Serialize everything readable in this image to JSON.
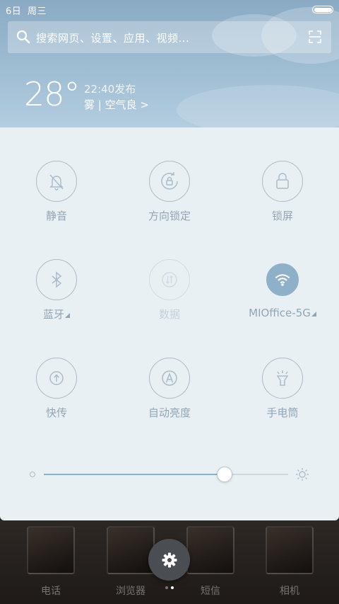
{
  "status_bar": {
    "date": "6日",
    "weekday": "周三"
  },
  "search": {
    "placeholder": "搜索网页、设置、应用、视频..."
  },
  "weather": {
    "temperature": "28°",
    "publish_time": "22:40发布",
    "condition": "雾 | 空气良 >"
  },
  "quick_settings": {
    "tiles": [
      {
        "label": "静音",
        "icon": "bell-off-icon",
        "state": "off"
      },
      {
        "label": "方向锁定",
        "icon": "rotation-lock-icon",
        "state": "off"
      },
      {
        "label": "锁屏",
        "icon": "lock-icon",
        "state": "off"
      },
      {
        "label": "蓝牙",
        "icon": "bluetooth-icon",
        "state": "off",
        "expandable": true
      },
      {
        "label": "数据",
        "icon": "mobile-data-icon",
        "state": "disabled"
      },
      {
        "label": "MIOffice-5G",
        "icon": "wifi-icon",
        "state": "on",
        "expandable": true
      },
      {
        "label": "快传",
        "icon": "quick-share-icon",
        "state": "off"
      },
      {
        "label": "自动亮度",
        "icon": "auto-brightness-icon",
        "state": "off"
      },
      {
        "label": "手电筒",
        "icon": "flashlight-icon",
        "state": "off"
      }
    ],
    "brightness_level": 0.74
  },
  "home_screen": {
    "apps": [
      {
        "label": "电话"
      },
      {
        "label": "浏览器"
      },
      {
        "label": "短信"
      },
      {
        "label": "相机"
      }
    ],
    "current_page": 1,
    "page_count": 2
  },
  "colors": {
    "accent": "#8eb0c9",
    "panel_bg": "#e9f0f4",
    "tile_text": "#8ea5b7"
  }
}
